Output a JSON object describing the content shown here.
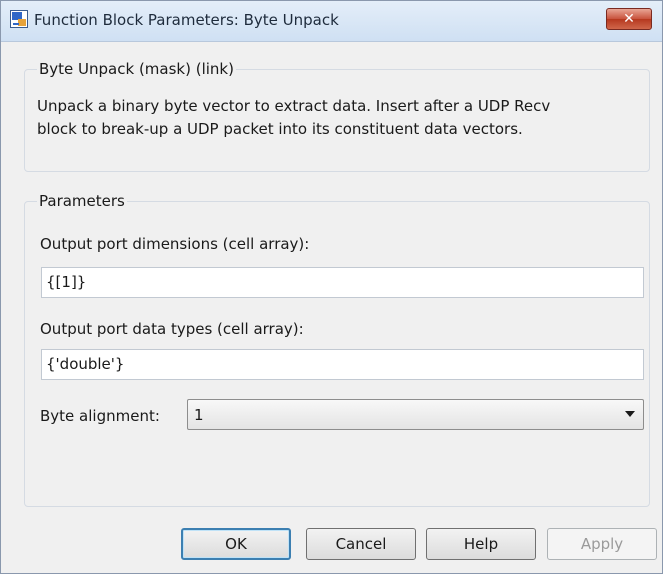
{
  "window": {
    "title": "Function Block Parameters: Byte Unpack",
    "close_label": "✕"
  },
  "description_group": {
    "legend": "Byte Unpack (mask) (link)",
    "line1": "Unpack a binary byte vector to extract data. Insert after a UDP Recv",
    "line2": "block to break-up a UDP packet into its constituent data vectors."
  },
  "parameters_group": {
    "legend": "Parameters",
    "dimensions_label": "Output port dimensions (cell array):",
    "dimensions_value": "{[1]}",
    "data_types_label": "Output port data types (cell array):",
    "data_types_value": "{'double'}",
    "alignment_label": "Byte alignment:",
    "alignment_value": "1"
  },
  "buttons": {
    "ok": "OK",
    "cancel": "Cancel",
    "help": "Help",
    "apply": "Apply"
  },
  "icons": {
    "app": "simulink-block-icon",
    "close": "close-icon",
    "dropdown": "chevron-down-icon"
  }
}
